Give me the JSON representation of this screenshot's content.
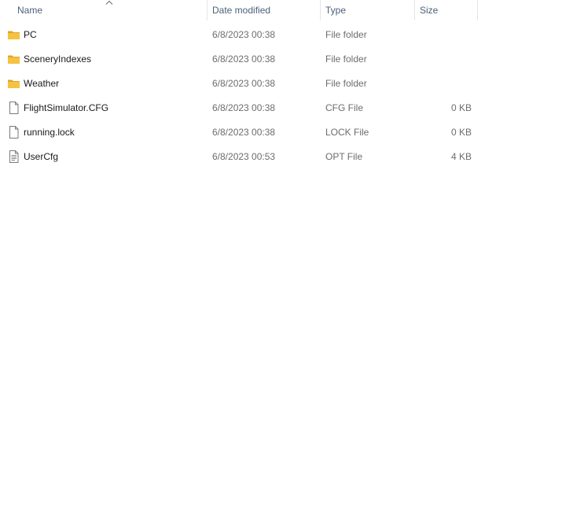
{
  "columns": {
    "name": "Name",
    "date": "Date modified",
    "type": "Type",
    "size": "Size"
  },
  "sort": {
    "column": "name",
    "direction": "ascending",
    "icon": "chevron-up-icon"
  },
  "colors": {
    "folder": "#f5c242",
    "folder_dark": "#e0a52a",
    "header_text": "#4c607a",
    "meta_text": "#6d6d6d"
  },
  "files": [
    {
      "name": "PC",
      "date": "6/8/2023 00:38",
      "type": "File folder",
      "size": "",
      "icon": "folder-icon"
    },
    {
      "name": "SceneryIndexes",
      "date": "6/8/2023 00:38",
      "type": "File folder",
      "size": "",
      "icon": "folder-icon"
    },
    {
      "name": "Weather",
      "date": "6/8/2023 00:38",
      "type": "File folder",
      "size": "",
      "icon": "folder-icon"
    },
    {
      "name": "FlightSimulator.CFG",
      "date": "6/8/2023 00:38",
      "type": "CFG File",
      "size": "0 KB",
      "icon": "file-icon"
    },
    {
      "name": "running.lock",
      "date": "6/8/2023 00:38",
      "type": "LOCK File",
      "size": "0 KB",
      "icon": "file-icon"
    },
    {
      "name": "UserCfg",
      "date": "6/8/2023 00:53",
      "type": "OPT File",
      "size": "4 KB",
      "icon": "text-file-icon"
    }
  ]
}
